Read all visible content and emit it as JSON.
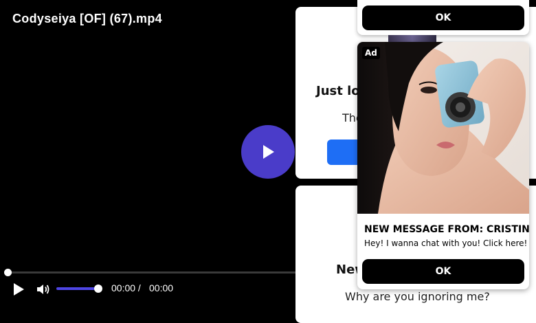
{
  "player": {
    "title": "Codyseiya [OF] (67).mp4",
    "current_time": "00:00 /",
    "duration": "00:00",
    "progress": 0.0,
    "volume": 1.0,
    "accent_color": "#4a3cc9"
  },
  "card1": {
    "heading": "Just loo",
    "text": "The"
  },
  "card2": {
    "heading": "New",
    "text": "Why are you ignoring me?"
  },
  "ad_top": {
    "ok_label": "OK"
  },
  "ad_main": {
    "badge": "Ad",
    "headline": "NEW MESSAGE FROM: CRISTINA",
    "body": "Hey! I wanna chat with you! Click here!",
    "ok_label": "OK"
  }
}
